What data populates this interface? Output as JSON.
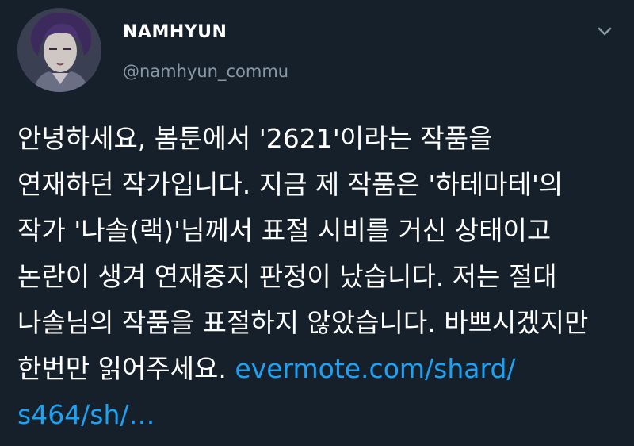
{
  "user": {
    "display_name": "NAMHYUN",
    "handle": "@namhyun_commu"
  },
  "icons": {
    "avatar": "profile-avatar",
    "menu": "chevron-down-icon"
  },
  "colors": {
    "background": "#15202b",
    "text": "#ffffff",
    "secondary_text": "#8899a6",
    "link": "#1da1f2"
  },
  "tweet": {
    "lines": [
      "안녕하세요, 봄툰에서 '2621'이라는 작품을",
      "연재하던 작가입니다. 지금 제 작품은 '하테마테'의",
      "작가 '나솔(랙)'님께서 표절 시비를 거신 상태이고",
      "논란이 생겨 연재중지 판정이 났습니다. 저는 절대",
      "나솔님의 작품을 표절하지 않았습니다. 바쁘시겠지만"
    ],
    "line6_text": "한번만 읽어주세요. ",
    "link_part1": "evermote.com/shard/",
    "link_part2": "s464/sh/…"
  }
}
